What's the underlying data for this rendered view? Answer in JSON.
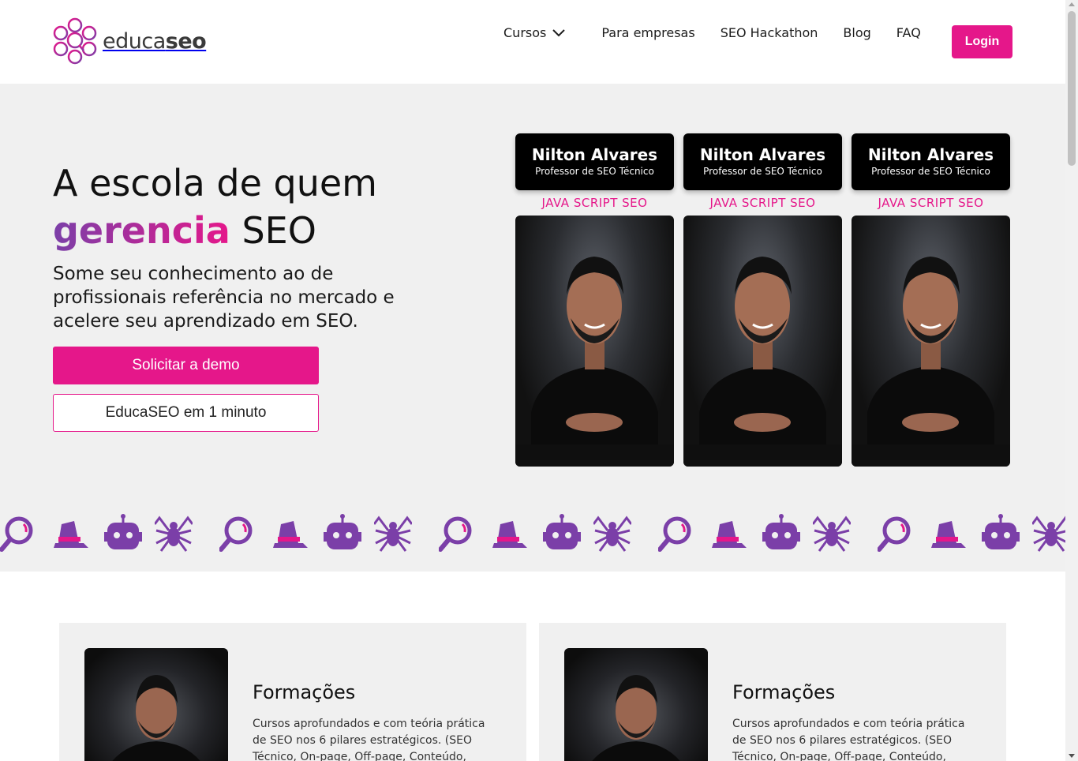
{
  "brand": {
    "logo_light": "educa",
    "logo_bold": "seo",
    "pink": "#e5178a",
    "purple": "#7b3fa8"
  },
  "nav": {
    "cursos": "Cursos",
    "para_empresas": "Para empresas",
    "seo_hackathon": "SEO Hackathon",
    "blog": "Blog",
    "faq": "FAQ",
    "login": "Login"
  },
  "hero": {
    "title_line1": "A escola de quem",
    "title_accent": "gerencia",
    "title_rest": "SEO",
    "subtitle": "Some seu conhecimento ao de profissionais referência no mercado e acelere seu aprendizado em SEO.",
    "cta_primary": "Solicitar a demo",
    "cta_secondary": "EducaSEO em 1 minuto"
  },
  "teachers": [
    {
      "name": "Nilton Alvares",
      "role": "Professor de SEO Técnico",
      "topic": "JAVA SCRIPT SEO"
    },
    {
      "name": "Nilton Alvares",
      "role": "Professor de SEO Técnico",
      "topic": "JAVA SCRIPT SEO"
    },
    {
      "name": "Nilton Alvares",
      "role": "Professor de SEO Técnico",
      "topic": "JAVA SCRIPT SEO"
    }
  ],
  "icon_strip": {
    "icons": [
      "magnifier-icon",
      "wizard-hat-icon",
      "robot-icon",
      "spider-icon"
    ]
  },
  "cards": [
    {
      "title": "Formações",
      "text": "Cursos aprofundados e com teória prática de SEO nos 6 pilares estratégicos. (SEO Técnico, On-page, Off-page, Conteúdo,"
    },
    {
      "title": "Formações",
      "text": "Cursos aprofundados e com teória prática de SEO nos 6 pilares estratégicos. (SEO Técnico, On-page, Off-page, Conteúdo,"
    }
  ]
}
